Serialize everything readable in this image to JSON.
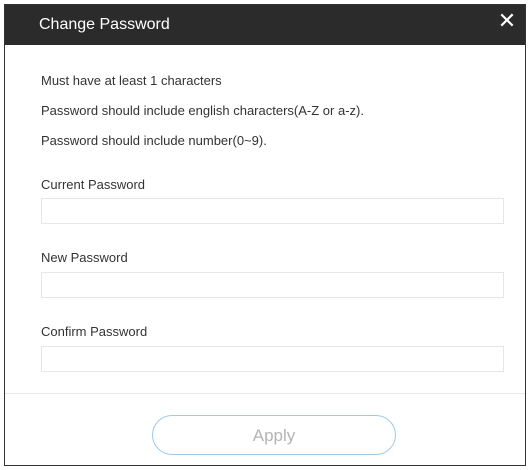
{
  "dialog": {
    "title": "Change Password",
    "close_glyph": "✕",
    "close_icon": "close-icon"
  },
  "rules": [
    "Must have at least 1 characters",
    "Password should include english characters(A-Z or a-z).",
    "Password should include number(0~9)."
  ],
  "fields": {
    "current_label": "Current Password",
    "current_value": "",
    "new_label": "New Password",
    "new_value": "",
    "confirm_label": "Confirm Password",
    "confirm_value": ""
  },
  "footer": {
    "apply_label": "Apply"
  },
  "colors": {
    "titlebar": "#2b2b2b",
    "apply_border": "#9ec9e8",
    "apply_text_disabled": "#b4b4b4"
  }
}
